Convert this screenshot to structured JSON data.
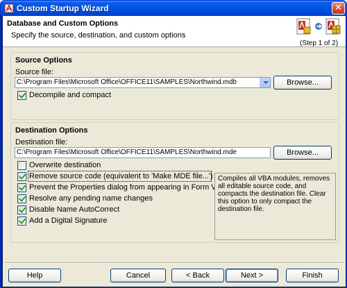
{
  "window": {
    "title": "Custom Startup Wizard",
    "close_glyph": "✕"
  },
  "header": {
    "title": "Database and Custom Options",
    "subtitle": "Specify the source, destination, and custom options",
    "step": "(Step 1 of 2)",
    "graphic_icons": [
      "database-icon",
      "arrow-right-icon",
      "package-icon"
    ]
  },
  "source": {
    "group_title": "Source Options",
    "file_label": "Source file:",
    "file_value": "C:\\Program Files\\Microsoft Office\\OFFICE11\\SAMPLES\\Northwind.mdb",
    "browse_label": "Browse...",
    "decompile_label": "Decompile and compact",
    "decompile_checked": true
  },
  "destination": {
    "group_title": "Destination Options",
    "file_label": "Destination file:",
    "file_value": "C:\\Program Files\\Microsoft Office\\OFFICE11\\SAMPLES\\Northwind.mde",
    "browse_label": "Browse...",
    "options": [
      {
        "label": "Overwrite destination",
        "checked": false
      },
      {
        "label": "Remove source code (equivalent to 'Make MDE file...')",
        "checked": true
      },
      {
        "label": "Prevent the Properties dialog from appearing in Form View",
        "checked": true
      },
      {
        "label": "Resolve any pending name changes",
        "checked": true
      },
      {
        "label": "Disable Name AutoCorrect",
        "checked": true
      },
      {
        "label": "Add a Digital Signature",
        "checked": true
      }
    ],
    "description": "Compiles all VBA modules, removes all editable source code, and compacts the destination file.  Clear this option to only compact the destination file."
  },
  "footer": {
    "help": "Help",
    "cancel": "Cancel",
    "back": "< Back",
    "next": "Next >",
    "finish": "Finish"
  },
  "colors": {
    "title_bar": "#0055e5",
    "dialog_bg": "#ece9d8",
    "checkmark": "#21a121"
  }
}
